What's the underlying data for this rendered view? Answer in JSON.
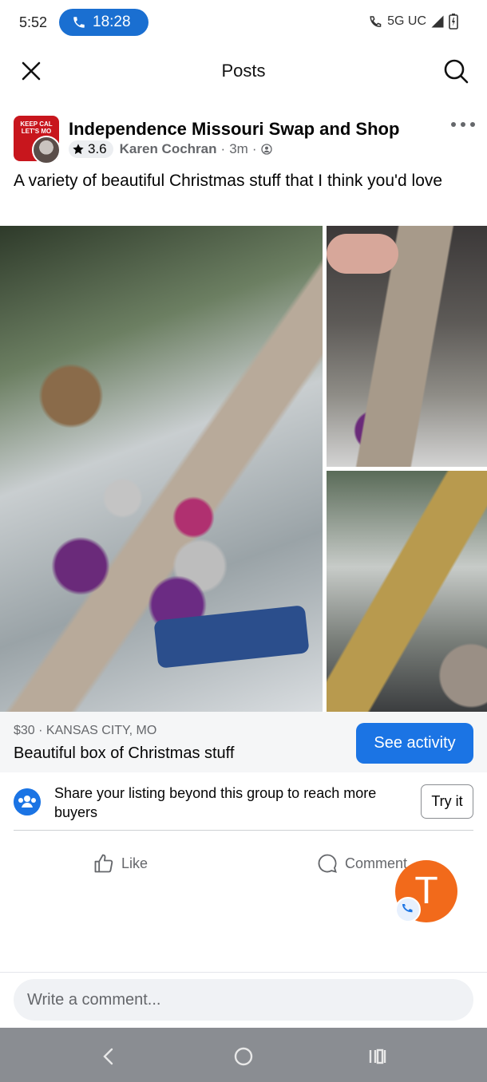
{
  "status_bar": {
    "time": "5:52",
    "call_timer": "18:28",
    "network": "5G UC"
  },
  "header": {
    "title": "Posts",
    "close_icon": "close-icon",
    "search_icon": "search-icon"
  },
  "post": {
    "group_name": "Independence Missouri Swap and Shop",
    "rating": "3.6",
    "author": "Karen Cochran",
    "time_ago": "3m",
    "separator": "·",
    "text": "A variety of beautiful Christmas stuff that I think you'd love",
    "group_avatar_text": "KEEP CAL LET'S MO",
    "privacy_icon": "group-privacy-icon"
  },
  "listing": {
    "price_location": "$30 · KANSAS CITY, MO",
    "title": "Beautiful box of Christmas stuff",
    "see_activity_label": "See activity"
  },
  "share_banner": {
    "text": "Share your listing beyond this group to reach more buyers",
    "try_label": "Try it"
  },
  "actions": {
    "like_label": "Like",
    "comment_label": "Comment"
  },
  "chat_head": {
    "initial": "T"
  },
  "composer": {
    "placeholder": "Write a comment..."
  },
  "colors": {
    "accent": "#1b74e4",
    "call_pill": "#1a6fd1",
    "chat_head": "#f26a1b",
    "navbar": "#8a8d92"
  }
}
